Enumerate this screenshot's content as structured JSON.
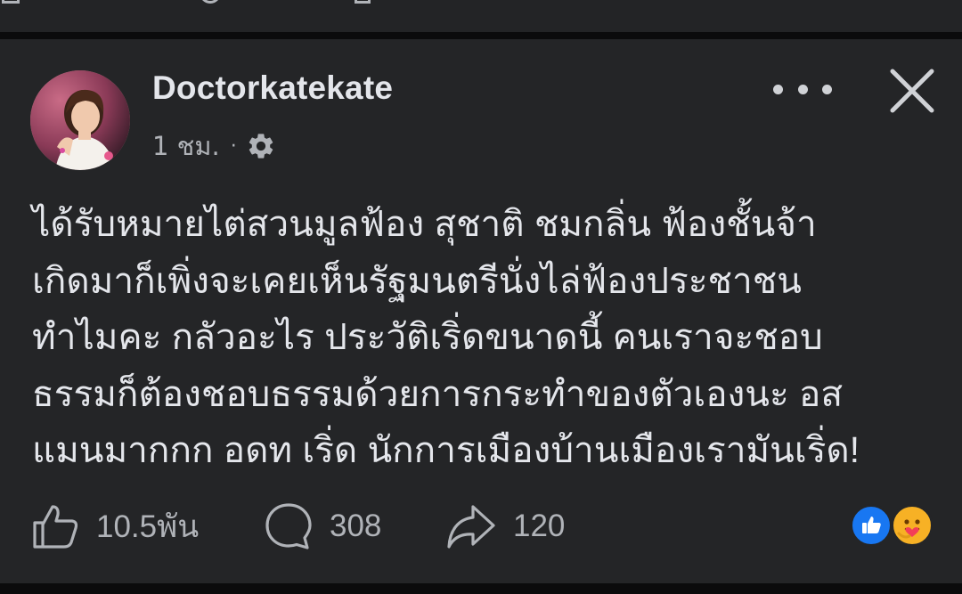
{
  "post": {
    "author": {
      "name": "Doctorkatekate"
    },
    "timestamp": "1 ชม.",
    "meta_separator": "·",
    "audience_icon": "gear-icon",
    "body_lines": [
      "ได้รับหมายไต่สวนมูลฟ้อง สุชาติ ชมกลิ่น ฟ้องชั้นจ้า",
      "เกิดมาก็เพิ่งจะเคยเห็นรัฐมนตรีนั่งไล่ฟ้องประชาชน",
      "ทำไมคะ กลัวอะไร ประวัติเริ่ดขนาดนี้ คนเราจะชอบ",
      "ธรรมก็ต้องชอบธรรมด้วยการกระทำของตัวเองนะ อส",
      "แมนมากกก อดท เริ่ด นักการเมืองบ้านเมืองเรามันเริ่ด!"
    ],
    "actions": {
      "like_count": "10.5พัน",
      "comment_count": "308",
      "share_count": "120"
    },
    "reactions": [
      "like",
      "care"
    ]
  },
  "icons": {
    "more": "more-options-icon",
    "close": "close-icon",
    "like": "thumbs-up-icon",
    "comment": "comment-bubble-icon",
    "share": "share-arrow-icon"
  },
  "colors": {
    "background": "#1c1d1f",
    "card": "#242527",
    "text_primary": "#e4e6eb",
    "text_secondary": "#b0b3b8",
    "like_blue": "#1877f2",
    "care_yellow": "#f7b125"
  }
}
